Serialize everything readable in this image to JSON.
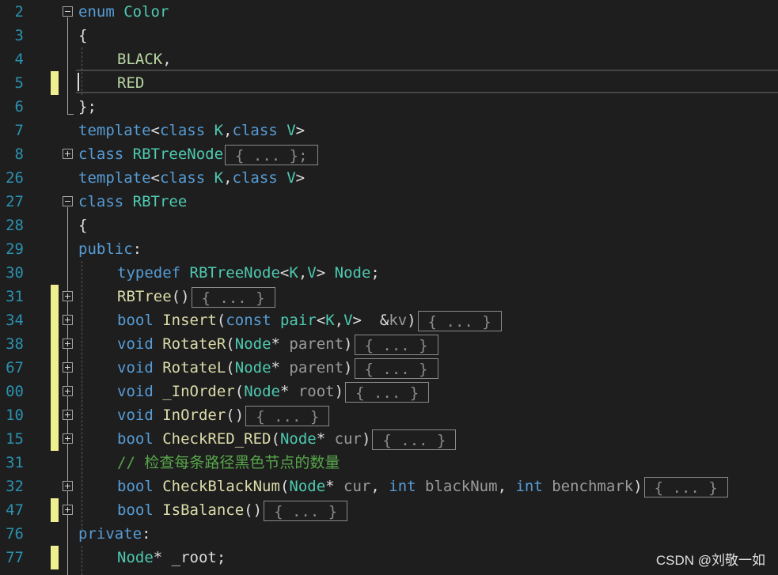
{
  "editor": {
    "lines": [
      {
        "num": "2",
        "fold": "minus",
        "bar": false,
        "indent": 0,
        "tokens": [
          {
            "c": "kw",
            "t": "enum"
          },
          {
            "c": "tx",
            "t": " "
          },
          {
            "c": "ty",
            "t": "Color"
          }
        ]
      },
      {
        "num": "3",
        "fold": "",
        "bar": false,
        "indent": 0,
        "tokens": [
          {
            "c": "tx",
            "t": "{"
          }
        ]
      },
      {
        "num": "4",
        "fold": "",
        "bar": false,
        "indent": 1,
        "tokens": [
          {
            "c": "en",
            "t": "BLACK"
          },
          {
            "c": "tx",
            "t": ","
          }
        ]
      },
      {
        "num": "5",
        "fold": "",
        "bar": true,
        "indent": 1,
        "tokens": [
          {
            "c": "en",
            "t": "RED"
          }
        ]
      },
      {
        "num": "6",
        "fold": "",
        "bar": false,
        "indent": 0,
        "tokens": [
          {
            "c": "tx",
            "t": "};"
          }
        ]
      },
      {
        "num": "7",
        "fold": "",
        "bar": false,
        "indent": 0,
        "tokens": [
          {
            "c": "kw",
            "t": "template"
          },
          {
            "c": "tx",
            "t": "<"
          },
          {
            "c": "kw",
            "t": "class"
          },
          {
            "c": "tx",
            "t": " "
          },
          {
            "c": "ty",
            "t": "K"
          },
          {
            "c": "tx",
            "t": ","
          },
          {
            "c": "kw",
            "t": "class"
          },
          {
            "c": "tx",
            "t": " "
          },
          {
            "c": "ty",
            "t": "V"
          },
          {
            "c": "tx",
            "t": ">"
          }
        ]
      },
      {
        "num": "8",
        "fold": "plus",
        "bar": false,
        "indent": 0,
        "tokens": [
          {
            "c": "kw",
            "t": "class"
          },
          {
            "c": "tx",
            "t": " "
          },
          {
            "c": "ty",
            "t": "RBTreeNode"
          }
        ],
        "collapsed": "{ ... };"
      },
      {
        "num": "26",
        "fold": "",
        "bar": false,
        "indent": 0,
        "tokens": [
          {
            "c": "kw",
            "t": "template"
          },
          {
            "c": "tx",
            "t": "<"
          },
          {
            "c": "kw",
            "t": "class"
          },
          {
            "c": "tx",
            "t": " "
          },
          {
            "c": "ty",
            "t": "K"
          },
          {
            "c": "tx",
            "t": ","
          },
          {
            "c": "kw",
            "t": "class"
          },
          {
            "c": "tx",
            "t": " "
          },
          {
            "c": "ty",
            "t": "V"
          },
          {
            "c": "tx",
            "t": ">"
          }
        ]
      },
      {
        "num": "27",
        "fold": "minus",
        "bar": false,
        "indent": 0,
        "tokens": [
          {
            "c": "kw",
            "t": "class"
          },
          {
            "c": "tx",
            "t": " "
          },
          {
            "c": "ty",
            "t": "RBTree"
          }
        ]
      },
      {
        "num": "28",
        "fold": "",
        "bar": false,
        "indent": 0,
        "tokens": [
          {
            "c": "tx",
            "t": "{"
          }
        ]
      },
      {
        "num": "29",
        "fold": "",
        "bar": false,
        "indent": 0,
        "tokens": [
          {
            "c": "kw",
            "t": "public"
          },
          {
            "c": "tx",
            "t": ":"
          }
        ]
      },
      {
        "num": "30",
        "fold": "",
        "bar": false,
        "indent": 1,
        "tokens": [
          {
            "c": "kw",
            "t": "typedef"
          },
          {
            "c": "tx",
            "t": " "
          },
          {
            "c": "ty",
            "t": "RBTreeNode"
          },
          {
            "c": "tx",
            "t": "<"
          },
          {
            "c": "ty",
            "t": "K"
          },
          {
            "c": "tx",
            "t": ","
          },
          {
            "c": "ty",
            "t": "V"
          },
          {
            "c": "tx",
            "t": "> "
          },
          {
            "c": "ty",
            "t": "Node"
          },
          {
            "c": "tx",
            "t": ";"
          }
        ]
      },
      {
        "num": "31",
        "fold": "plus",
        "bar": true,
        "indent": 1,
        "tokens": [
          {
            "c": "fn",
            "t": "RBTree"
          },
          {
            "c": "tx",
            "t": "()"
          }
        ],
        "collapsed": "{ ... }"
      },
      {
        "num": "34",
        "fold": "plus",
        "bar": true,
        "indent": 1,
        "tokens": [
          {
            "c": "kw",
            "t": "bool"
          },
          {
            "c": "tx",
            "t": " "
          },
          {
            "c": "fn",
            "t": "Insert"
          },
          {
            "c": "tx",
            "t": "("
          },
          {
            "c": "kw",
            "t": "const"
          },
          {
            "c": "tx",
            "t": " "
          },
          {
            "c": "ty",
            "t": "pair"
          },
          {
            "c": "tx",
            "t": "<"
          },
          {
            "c": "ty",
            "t": "K"
          },
          {
            "c": "tx",
            "t": ","
          },
          {
            "c": "ty",
            "t": "V"
          },
          {
            "c": "tx",
            "t": ">  &"
          },
          {
            "c": "pm",
            "t": "kv"
          },
          {
            "c": "tx",
            "t": ")"
          }
        ],
        "collapsed": "{ ... }"
      },
      {
        "num": "38",
        "fold": "plus",
        "bar": true,
        "indent": 1,
        "tokens": [
          {
            "c": "kw",
            "t": "void"
          },
          {
            "c": "tx",
            "t": " "
          },
          {
            "c": "fn",
            "t": "RotateR"
          },
          {
            "c": "tx",
            "t": "("
          },
          {
            "c": "ty",
            "t": "Node"
          },
          {
            "c": "tx",
            "t": "* "
          },
          {
            "c": "pm",
            "t": "parent"
          },
          {
            "c": "tx",
            "t": ")"
          }
        ],
        "collapsed": "{ ... }"
      },
      {
        "num": "67",
        "fold": "plus",
        "bar": true,
        "indent": 1,
        "tokens": [
          {
            "c": "kw",
            "t": "void"
          },
          {
            "c": "tx",
            "t": " "
          },
          {
            "c": "fn",
            "t": "RotateL"
          },
          {
            "c": "tx",
            "t": "("
          },
          {
            "c": "ty",
            "t": "Node"
          },
          {
            "c": "tx",
            "t": "* "
          },
          {
            "c": "pm",
            "t": "parent"
          },
          {
            "c": "tx",
            "t": ")"
          }
        ],
        "collapsed": "{ ... }"
      },
      {
        "num": "00",
        "fold": "plus",
        "bar": true,
        "indent": 1,
        "tokens": [
          {
            "c": "kw",
            "t": "void"
          },
          {
            "c": "tx",
            "t": " "
          },
          {
            "c": "fn",
            "t": "_InOrder"
          },
          {
            "c": "tx",
            "t": "("
          },
          {
            "c": "ty",
            "t": "Node"
          },
          {
            "c": "tx",
            "t": "* "
          },
          {
            "c": "pm",
            "t": "root"
          },
          {
            "c": "tx",
            "t": ")"
          }
        ],
        "collapsed": "{ ... }"
      },
      {
        "num": "10",
        "fold": "plus",
        "bar": true,
        "indent": 1,
        "tokens": [
          {
            "c": "kw",
            "t": "void"
          },
          {
            "c": "tx",
            "t": " "
          },
          {
            "c": "fn",
            "t": "InOrder"
          },
          {
            "c": "tx",
            "t": "()"
          }
        ],
        "collapsed": "{ ... }"
      },
      {
        "num": "15",
        "fold": "plus",
        "bar": true,
        "indent": 1,
        "tokens": [
          {
            "c": "kw",
            "t": "bool"
          },
          {
            "c": "tx",
            "t": " "
          },
          {
            "c": "fn",
            "t": "CheckRED_RED"
          },
          {
            "c": "tx",
            "t": "("
          },
          {
            "c": "ty",
            "t": "Node"
          },
          {
            "c": "tx",
            "t": "* "
          },
          {
            "c": "pm",
            "t": "cur"
          },
          {
            "c": "tx",
            "t": ")"
          }
        ],
        "collapsed": "{ ... }"
      },
      {
        "num": "31",
        "fold": "",
        "bar": false,
        "indent": 1,
        "tokens": [
          {
            "c": "cm",
            "t": "// 检查每条路径黑色节点的数量"
          }
        ]
      },
      {
        "num": "32",
        "fold": "plus",
        "bar": false,
        "indent": 1,
        "tokens": [
          {
            "c": "kw",
            "t": "bool"
          },
          {
            "c": "tx",
            "t": " "
          },
          {
            "c": "fn",
            "t": "CheckBlackNum"
          },
          {
            "c": "tx",
            "t": "("
          },
          {
            "c": "ty",
            "t": "Node"
          },
          {
            "c": "tx",
            "t": "* "
          },
          {
            "c": "pm",
            "t": "cur"
          },
          {
            "c": "tx",
            "t": ", "
          },
          {
            "c": "kw",
            "t": "int"
          },
          {
            "c": "tx",
            "t": " "
          },
          {
            "c": "pm",
            "t": "blackNum"
          },
          {
            "c": "tx",
            "t": ", "
          },
          {
            "c": "kw",
            "t": "int"
          },
          {
            "c": "tx",
            "t": " "
          },
          {
            "c": "pm",
            "t": "benchmark"
          },
          {
            "c": "tx",
            "t": ")"
          }
        ],
        "collapsed": "{ ... }"
      },
      {
        "num": "47",
        "fold": "plus",
        "bar": true,
        "indent": 1,
        "tokens": [
          {
            "c": "kw",
            "t": "bool"
          },
          {
            "c": "tx",
            "t": " "
          },
          {
            "c": "fn",
            "t": "IsBalance"
          },
          {
            "c": "tx",
            "t": "()"
          }
        ],
        "collapsed": "{ ... }"
      },
      {
        "num": "76",
        "fold": "",
        "bar": false,
        "indent": 0,
        "tokens": [
          {
            "c": "kw",
            "t": "private"
          },
          {
            "c": "tx",
            "t": ":"
          }
        ]
      },
      {
        "num": "77",
        "fold": "",
        "bar": true,
        "indent": 1,
        "tokens": [
          {
            "c": "ty",
            "t": "Node"
          },
          {
            "c": "tx",
            "t": "* "
          },
          {
            "c": "tx",
            "t": "_root;"
          }
        ]
      }
    ]
  },
  "watermark": "CSDN @刘敬一如",
  "colors": {
    "background": "#1e1e1e",
    "line_number": "#2b91af",
    "keyword": "#569cd6",
    "type": "#4ec9b0",
    "function": "#dcdcaa",
    "comment": "#57a64a",
    "change_bar": "#efef91"
  }
}
